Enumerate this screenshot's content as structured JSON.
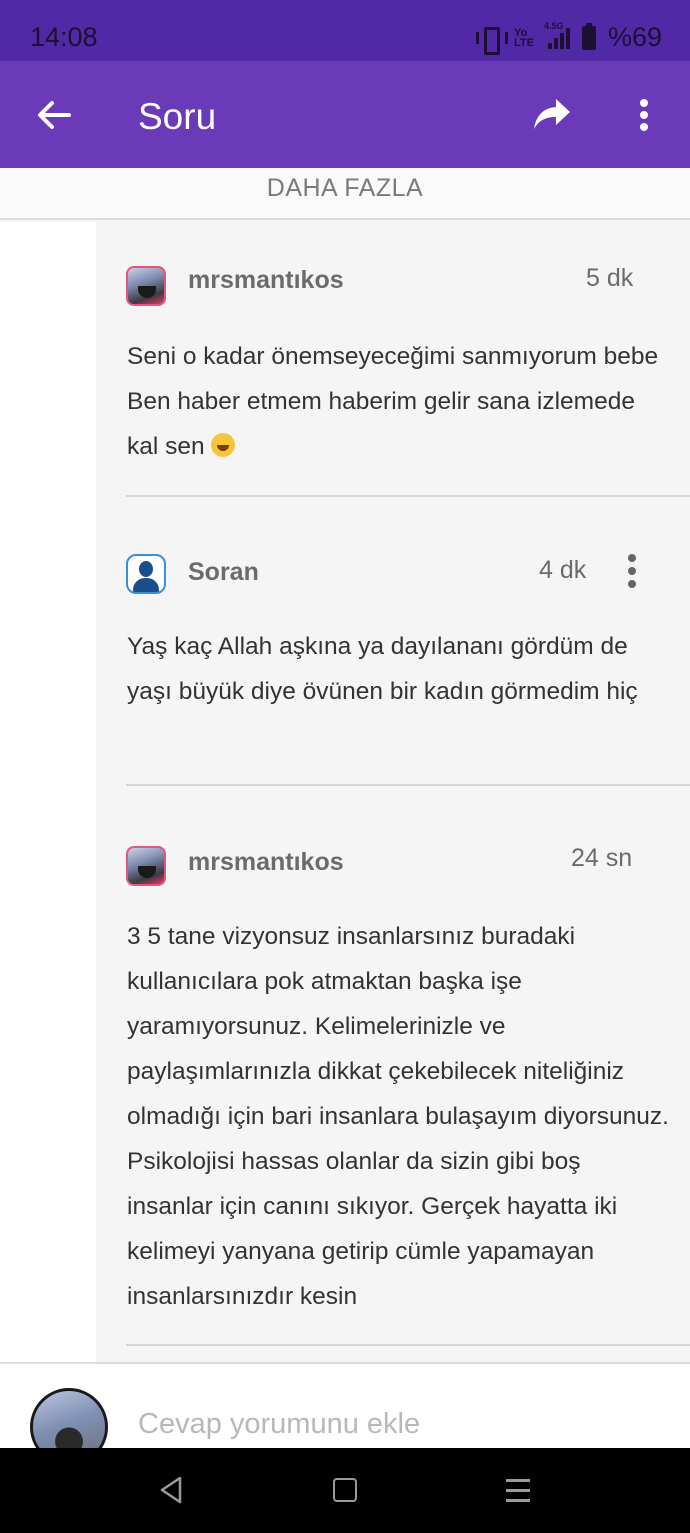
{
  "status_bar": {
    "time": "14:08",
    "network": "4.5G",
    "volte": "Yo LTE",
    "battery": "%69"
  },
  "app_bar": {
    "title": "Soru",
    "back_icon": "arrow-back-icon",
    "share_icon": "share-icon",
    "menu_icon": "more-vert-icon"
  },
  "load_more": {
    "label": "DAHA FAZLA"
  },
  "comments": [
    {
      "user": "mrsmantıkos",
      "time": "5 dk",
      "text": "Seni o kadar önemseyeceğimi sanmıyorum bebe Ben haber etmem haberim gelir sana izlemede kal sen",
      "emoji": "face-with-tears-of-joy"
    },
    {
      "user": "Soran",
      "time": "4 dk",
      "text": "Yaş kaç Allah aşkına ya dayılananı gördüm de yaşı büyük diye övünen bir kadın görmedim hiç"
    },
    {
      "user": "mrsmantıkos",
      "time": "24 sn",
      "text": "3 5 tane vizyonsuz insanlarsınız buradaki kullanıcılara pok atmaktan başka işe yaramıyorsunuz. Kelimelerinizle ve paylaşımlarınızla dikkat çekebilecek niteliğiniz olmadığı için bari insanlara bulaşayım diyorsunuz. Psikolojisi hassas olanlar da sizin gibi boş insanlar için canını sıkıyor. Gerçek hayatta iki kelimeyi yanyana getirip cümle yapamayan insanlarsınızdır kesin"
    }
  ],
  "composer": {
    "placeholder": "Cevap yorumunu ekle"
  },
  "colors": {
    "status_bar": "#5128a6",
    "app_bar": "#6a3ab8",
    "thread_bg": "#f5f5f5"
  }
}
